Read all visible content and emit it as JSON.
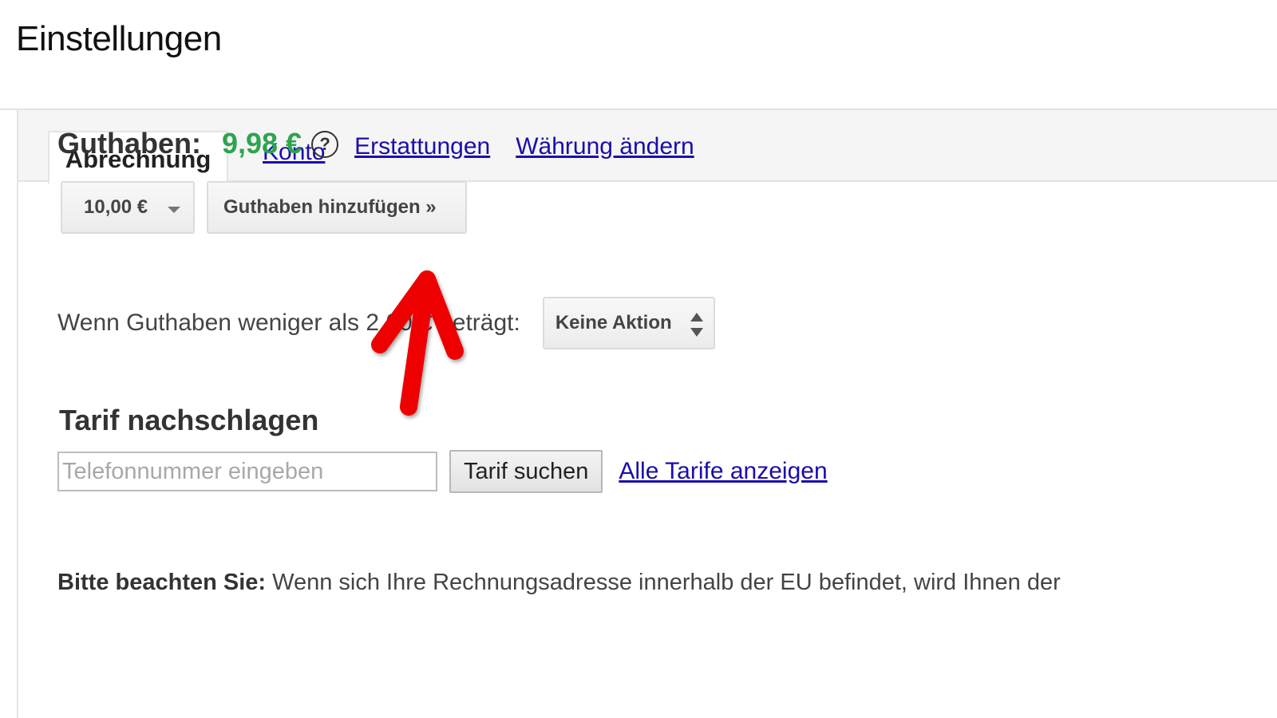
{
  "header": {
    "title": "Einstellungen"
  },
  "tabs": [
    {
      "label": "Abrechnung",
      "active": true
    },
    {
      "label": "Konto",
      "active": false
    }
  ],
  "balance": {
    "label": "Guthaben:",
    "value": "9,98 €",
    "help_symbol": "?",
    "refunds_link": "Erstattungen",
    "currency_link": "Währung ändern"
  },
  "add_credit": {
    "amount_selected": "10,00 €",
    "button_label": "Guthaben hinzufügen »"
  },
  "auto_recharge": {
    "text": "Wenn Guthaben weniger als 2,00 € beträgt:",
    "action_selected": "Keine Aktion"
  },
  "tariff_lookup": {
    "title": "Tarif nachschlagen",
    "input_value": "",
    "input_placeholder": "Telefonnummer eingeben",
    "search_button": "Tarif suchen",
    "all_rates_link": "Alle Tarife anzeigen"
  },
  "notice": {
    "label": "Bitte beachten Sie:",
    "text": "Wenn sich Ihre Rechnungsadresse innerhalb der EU befindet, wird Ihnen der"
  },
  "annotation": {
    "icon": "red-arrow-icon",
    "color": "#ee0000"
  },
  "colors": {
    "balance_green": "#2da44e",
    "link_blue": "#1a0dab"
  }
}
